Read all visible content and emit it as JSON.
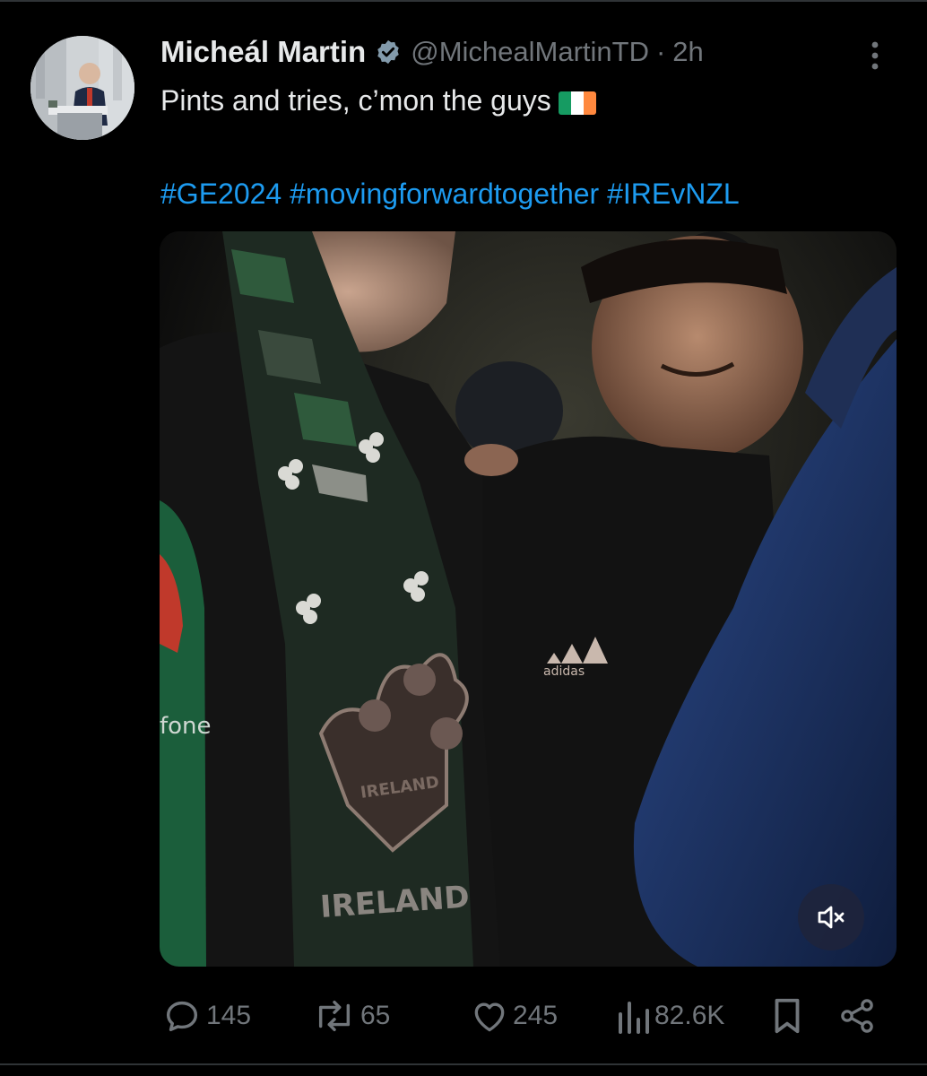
{
  "tweet": {
    "author": {
      "display_name": "Micheál Martin",
      "handle": "@MichealMartinTD",
      "verified": true
    },
    "separator": "·",
    "timestamp": "2h",
    "text": "Pints and tries, c’mon the guys",
    "text_emoji": "flag-ireland",
    "hashtags": [
      "#GE2024",
      "#movingforwardtogether",
      "#IREvNZL"
    ]
  },
  "media": {
    "type": "video",
    "muted": true,
    "visible_text": {
      "scarf_crest": "IRELAND",
      "scarf": "IRELAND",
      "jersey_brand": "adidas",
      "jersey_sponsor": "fone"
    }
  },
  "actions": {
    "replies": "145",
    "reposts": "65",
    "likes": "245",
    "views": "82.6K"
  },
  "colors": {
    "background": "#000000",
    "text_primary": "#e7e9ea",
    "text_secondary": "#71767b",
    "link": "#1d9bf0",
    "divider": "#2f3336"
  },
  "icons": {
    "verified": "verified-badge-icon",
    "more": "more-vertical-icon",
    "reply": "reply-icon",
    "repost": "repost-icon",
    "like": "heart-icon",
    "views": "views-chart-icon",
    "bookmark": "bookmark-icon",
    "share": "share-icon",
    "mute": "muted-speaker-icon"
  }
}
